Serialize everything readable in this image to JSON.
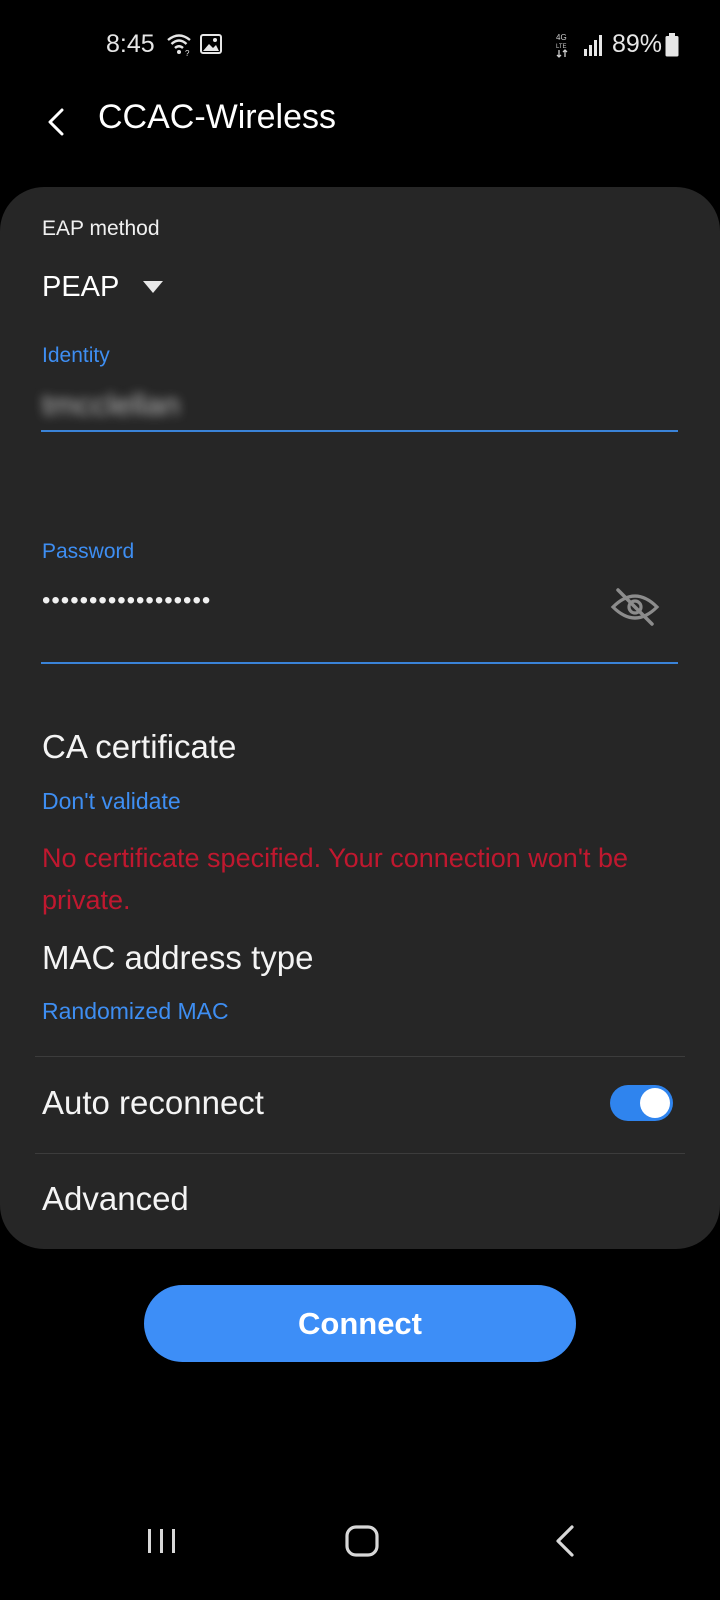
{
  "status_bar": {
    "time": "8:45",
    "battery_percent": "89%",
    "network_badge_top": "4G",
    "network_badge_bottom": "LTE",
    "icons": [
      "wifi-icon",
      "gallery-icon",
      "lte-icon",
      "signal-icon",
      "battery-icon"
    ]
  },
  "header": {
    "title": "CCAC-Wireless"
  },
  "eap": {
    "label": "EAP method",
    "value": "PEAP"
  },
  "identity": {
    "label": "Identity",
    "value": "tmcclellan"
  },
  "password": {
    "label": "Password",
    "value": "••••••••••••••••••"
  },
  "ca_certificate": {
    "title": "CA certificate",
    "value": "Don't validate",
    "warning": "No certificate specified. Your connection won't be private."
  },
  "mac_address": {
    "title": "MAC address type",
    "value": "Randomized MAC"
  },
  "auto_reconnect": {
    "label": "Auto reconnect",
    "enabled": true
  },
  "advanced": {
    "label": "Advanced"
  },
  "connect_button": {
    "label": "Connect"
  },
  "colors": {
    "background": "#000000",
    "card": "#262626",
    "accent": "#3e8ef2",
    "warning": "#c0182f",
    "button": "#3d8ef7"
  }
}
